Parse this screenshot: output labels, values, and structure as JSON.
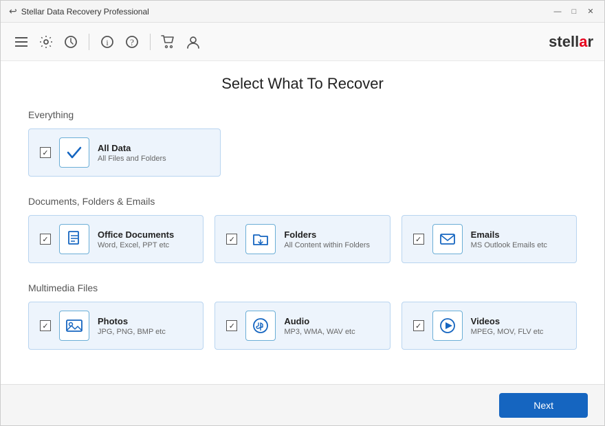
{
  "titleBar": {
    "title": "Stellar Data Recovery Professional",
    "minimizeLabel": "—",
    "maximizeLabel": "□",
    "closeLabel": "✕"
  },
  "toolbar": {
    "logo": "stell",
    "logo_accent": "ar"
  },
  "main": {
    "pageTitle": "Select What To Recover",
    "sections": [
      {
        "label": "Everything",
        "cards": [
          {
            "id": "all-data",
            "title": "All Data",
            "subtitle": "All Files and Folders",
            "checked": true,
            "icon": "checkmark"
          }
        ]
      },
      {
        "label": "Documents, Folders & Emails",
        "cards": [
          {
            "id": "office-docs",
            "title": "Office Documents",
            "subtitle": "Word, Excel, PPT etc",
            "checked": true,
            "icon": "document"
          },
          {
            "id": "folders",
            "title": "Folders",
            "subtitle": "All Content within Folders",
            "checked": true,
            "icon": "folder"
          },
          {
            "id": "emails",
            "title": "Emails",
            "subtitle": "MS Outlook Emails etc",
            "checked": true,
            "icon": "email"
          }
        ]
      },
      {
        "label": "Multimedia Files",
        "cards": [
          {
            "id": "photos",
            "title": "Photos",
            "subtitle": "JPG, PNG, BMP etc",
            "checked": true,
            "icon": "photo"
          },
          {
            "id": "audio",
            "title": "Audio",
            "subtitle": "MP3, WMA, WAV etc",
            "checked": true,
            "icon": "audio"
          },
          {
            "id": "videos",
            "title": "Videos",
            "subtitle": "MPEG, MOV, FLV etc",
            "checked": true,
            "icon": "video"
          }
        ]
      }
    ]
  },
  "footer": {
    "nextLabel": "Next"
  }
}
